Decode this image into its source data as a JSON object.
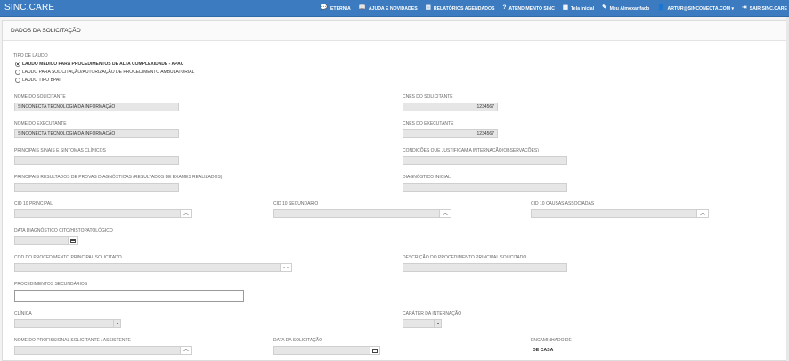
{
  "app": {
    "brand": "SINC.CARE"
  },
  "nav": [
    {
      "icon": "💬",
      "icon_name": "chat-icon",
      "label": "ETERNIA"
    },
    {
      "icon": "📖",
      "icon_name": "book-icon",
      "label": "AJUDA E NOVIDADES"
    },
    {
      "icon": "▤",
      "icon_name": "report-icon",
      "label": "RELATÓRIOS AGENDADOS"
    },
    {
      "icon": "?",
      "icon_name": "help-circle-icon",
      "label": "ATENDIMENTO SINC"
    },
    {
      "icon": "▦",
      "icon_name": "calendar-icon",
      "label": "Tela inicial"
    },
    {
      "icon": "✎",
      "icon_name": "edit-icon",
      "label": "Meu Almoxarifado"
    },
    {
      "icon": "👤",
      "icon_name": "user-icon",
      "label": "ARTUR@SINCONECTA.COM ▾"
    },
    {
      "icon": "⇥",
      "icon_name": "logout-icon",
      "label": "SAIR SINC.CARE"
    }
  ],
  "panel": {
    "title": "DADOS DA SOLICITAÇÃO"
  },
  "tipo_laudo": {
    "label": "TIPO DE LAUDO",
    "options": [
      {
        "label": "LAUDO MÉDICO PARA PROCEDIMENTOS DE ALTA COMPLEXIDADE - APAC",
        "selected": true
      },
      {
        "label": "LAUDO PARA SOLICITAÇÃO/AUTORIZAÇÃO DE PROCEDIMENTO AMBULATORIAL",
        "selected": false
      },
      {
        "label": "LAUDO TIPO BPAI",
        "selected": false
      }
    ]
  },
  "fields": {
    "nome_solicitante": {
      "label": "NOME DO SOLICITANTE",
      "value": "SINCONECTA TECNOLOGIA DA INFORMAÇÃO"
    },
    "cnes_solicitante": {
      "label": "CNES DO SOLICITANTE",
      "value": "1234567"
    },
    "nome_executante": {
      "label": "NOME DO EXECUTANTE",
      "value": "SINCONECTA TECNOLOGIA DA INFORMAÇÃO"
    },
    "cnes_executante": {
      "label": "CNES DO EXECUTANTE",
      "value": "1234567"
    },
    "sinais_sintomas": {
      "label": "PRINCIPAIS SINAIS E SINTOMAS CLÍNICOS",
      "value": ""
    },
    "condicoes": {
      "label": "CONDIÇÕES QUE JUSTIFICAM A INTERNAÇÃO(OBSERVAÇÕES)",
      "value": ""
    },
    "resultados": {
      "label": "PRINCIPAIS RESULTADOS DE PROVAS DIAGNÓSTICAS (RESULTADOS DE EXAMES REALIZADOS)",
      "value": ""
    },
    "diagnostico": {
      "label": "DIAGNÓSTICO INICIAL",
      "value": ""
    },
    "cid_principal": {
      "label": "CID 10 PRINCIPAL",
      "value": ""
    },
    "cid_secundario": {
      "label": "CID 10 SECUNDÁRIO",
      "value": ""
    },
    "cid_associadas": {
      "label": "CID 10 CAUSAS ASSOCIADAS",
      "value": ""
    },
    "data_diagnostico": {
      "label": "DATA DIAGNÓSTICO CITO/HISTOPATOLÓGICO",
      "value": ""
    },
    "cod_procedimento": {
      "label": "COD DO PROCEDIMENTO PRINCIPAL SOLICITADO",
      "value": ""
    },
    "desc_procedimento": {
      "label": "DESCRIÇÃO DO PROCEDIMENTO PRINCIPAL SOLICITADO",
      "value": ""
    },
    "proc_secundarios": {
      "label": "PROCEDIMENTOS SECUNDÁRIOS",
      "value": ""
    },
    "clinica": {
      "label": "CLÍNICA",
      "value": ""
    },
    "carater": {
      "label": "CARÁTER DA INTERNAÇÃO",
      "value": ""
    },
    "nome_profissional": {
      "label": "NOME DO PROFISSIONAL SOLICITANTE / ASSISTENTE",
      "value": ""
    },
    "data_solicitacao": {
      "label": "DATA DA SOLICITAÇÃO",
      "value": ""
    },
    "encaminhado": {
      "label": "ENCAMINHADO DE",
      "value": "DE CASA"
    }
  }
}
